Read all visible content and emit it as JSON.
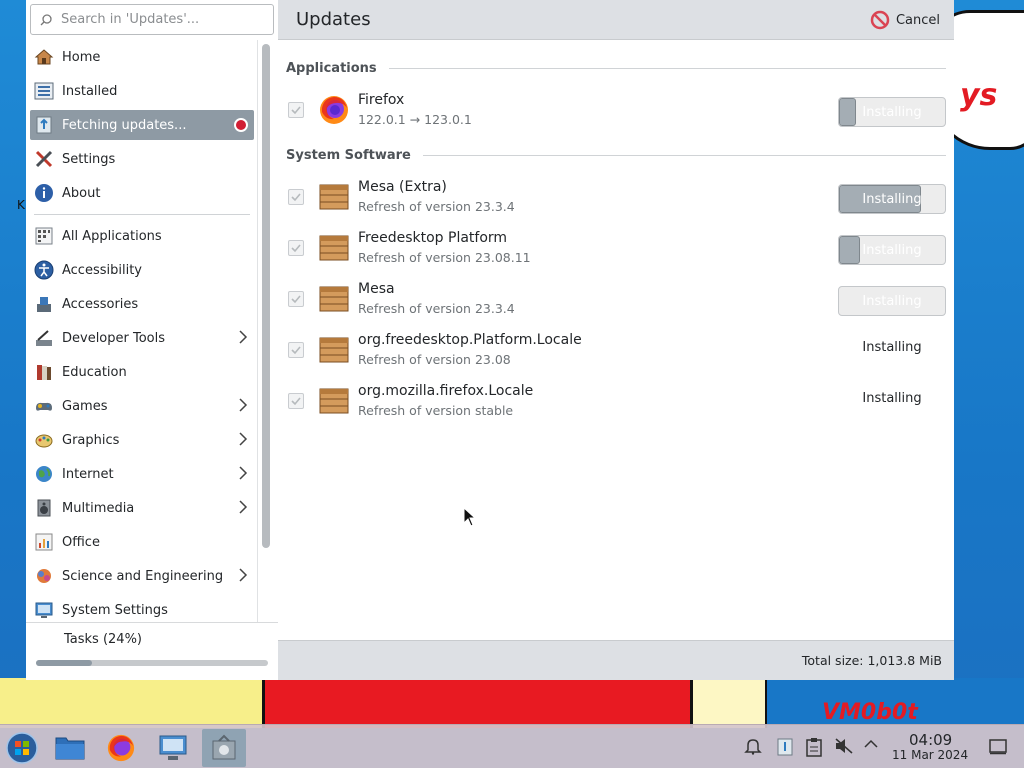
{
  "search": {
    "placeholder": "Search in 'Updates'..."
  },
  "menu": {
    "top_items": [
      {
        "label": "Home",
        "icon": "home-icon"
      },
      {
        "label": "Installed",
        "icon": "installed-icon"
      },
      {
        "label": "Fetching updates...",
        "icon": "updates-icon",
        "active": true
      },
      {
        "label": "Settings",
        "icon": "settings-icon"
      },
      {
        "label": "About",
        "icon": "about-icon"
      }
    ],
    "categories": [
      {
        "label": "All Applications",
        "has_submenu": false
      },
      {
        "label": "Accessibility",
        "has_submenu": false
      },
      {
        "label": "Accessories",
        "has_submenu": false
      },
      {
        "label": "Developer Tools",
        "has_submenu": true
      },
      {
        "label": "Education",
        "has_submenu": false
      },
      {
        "label": "Games",
        "has_submenu": true
      },
      {
        "label": "Graphics",
        "has_submenu": true
      },
      {
        "label": "Internet",
        "has_submenu": true
      },
      {
        "label": "Multimedia",
        "has_submenu": true
      },
      {
        "label": "Office",
        "has_submenu": false
      },
      {
        "label": "Science and Engineering",
        "has_submenu": true
      },
      {
        "label": "System Settings",
        "has_submenu": false
      }
    ]
  },
  "tasks": {
    "label": "Tasks (24%)",
    "progress": 0.24
  },
  "panel": {
    "title": "Updates",
    "cancel_label": "Cancel",
    "sections": {
      "applications": "Applications",
      "system": "System Software"
    },
    "apps": [
      {
        "name": "Firefox",
        "sub": "122.0.1 → 123.0.1",
        "status": "Installing",
        "progress": 0.12,
        "style": "bar"
      }
    ],
    "system": [
      {
        "name": "Mesa (Extra)",
        "sub": "Refresh of version 23.3.4",
        "status": "Installing",
        "progress": 0.77,
        "style": "bar"
      },
      {
        "name": "Freedesktop Platform",
        "sub": "Refresh of version 23.08.11",
        "status": "Installing",
        "progress": 0.2,
        "style": "bar"
      },
      {
        "name": "Mesa",
        "sub": "Refresh of version 23.3.4",
        "status": "Installing",
        "progress": 0.0,
        "style": "bar"
      },
      {
        "name": "org.freedesktop.Platform.Locale",
        "sub": "Refresh of version 23.08",
        "status": "Installing",
        "style": "text"
      },
      {
        "name": "org.mozilla.firefox.Locale",
        "sub": "Refresh of version stable",
        "status": "Installing",
        "style": "text"
      }
    ],
    "total_size": "Total size: 1,013.8 MiB"
  },
  "taskbar": {
    "clock_time": "04:09",
    "clock_date": "11 Mar 2024"
  },
  "wallpaper": {
    "cloud_text": "ys",
    "corner_text": "VM0b0t",
    "edge_letter": "K"
  }
}
